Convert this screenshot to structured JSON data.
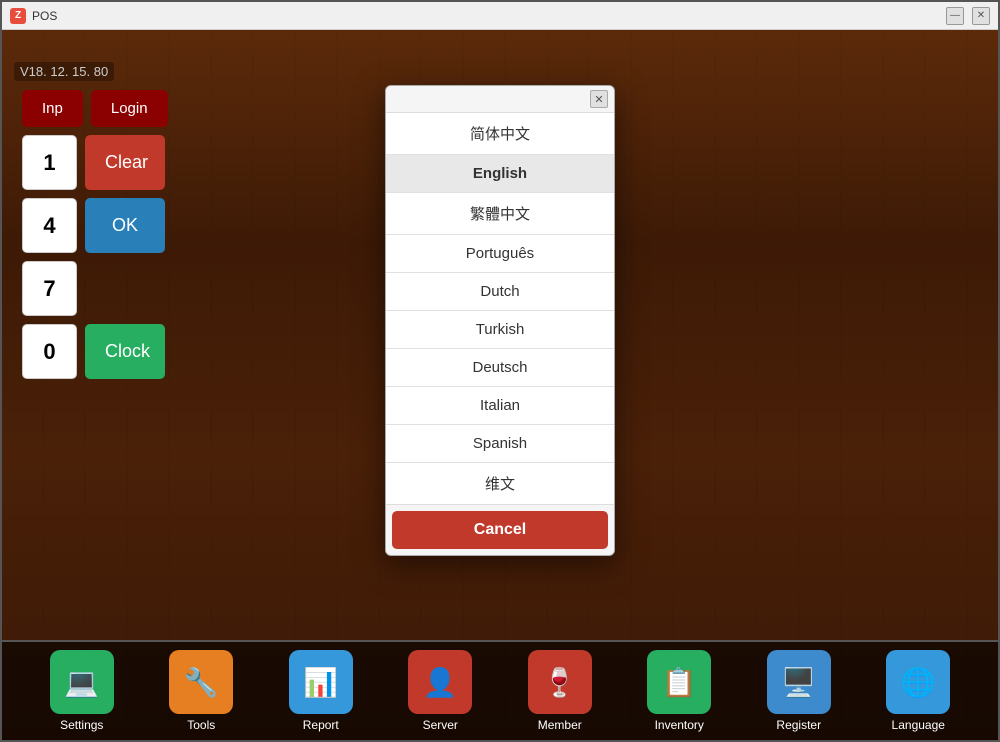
{
  "window": {
    "title": "POS",
    "version": "V18. 12. 15. 80",
    "icon": "Z"
  },
  "title_controls": {
    "minimize": "—",
    "close": "✕"
  },
  "numpad": {
    "input_label": "Inp",
    "login_label": "Login",
    "buttons": [
      "1",
      "4",
      "7",
      "0"
    ],
    "clear_label": "Clear",
    "ok_label": "OK",
    "clock_label": "Clock"
  },
  "modal": {
    "close": "✕",
    "cancel_label": "Cancel",
    "languages": [
      {
        "id": "simplified-chinese",
        "label": "简体中文"
      },
      {
        "id": "english",
        "label": "English",
        "selected": true
      },
      {
        "id": "traditional-chinese",
        "label": "繁體中文"
      },
      {
        "id": "portuguese",
        "label": "Português"
      },
      {
        "id": "dutch",
        "label": "Dutch"
      },
      {
        "id": "turkish",
        "label": "Turkish"
      },
      {
        "id": "deutsch",
        "label": "Deutsch"
      },
      {
        "id": "italian",
        "label": "Italian"
      },
      {
        "id": "spanish",
        "label": "Spanish"
      },
      {
        "id": "uyghur",
        "label": "维文"
      }
    ]
  },
  "toolbar": {
    "items": [
      {
        "id": "settings",
        "label": "Settings",
        "icon": "💻",
        "color": "#27ae60"
      },
      {
        "id": "tools",
        "label": "Tools",
        "icon": "🔧",
        "color": "#e67e22"
      },
      {
        "id": "report",
        "label": "Report",
        "icon": "📊",
        "color": "#3498db"
      },
      {
        "id": "server",
        "label": "Server",
        "icon": "👤",
        "color": "#c0392b"
      },
      {
        "id": "member",
        "label": "Member",
        "icon": "🍷",
        "color": "#c0392b"
      },
      {
        "id": "inventory",
        "label": "Inventory",
        "icon": "📋",
        "color": "#27ae60"
      },
      {
        "id": "register",
        "label": "Register",
        "icon": "🖥",
        "color": "#3d8bcd"
      },
      {
        "id": "language",
        "label": "Language",
        "icon": "🌐",
        "color": "#3498db"
      }
    ]
  }
}
